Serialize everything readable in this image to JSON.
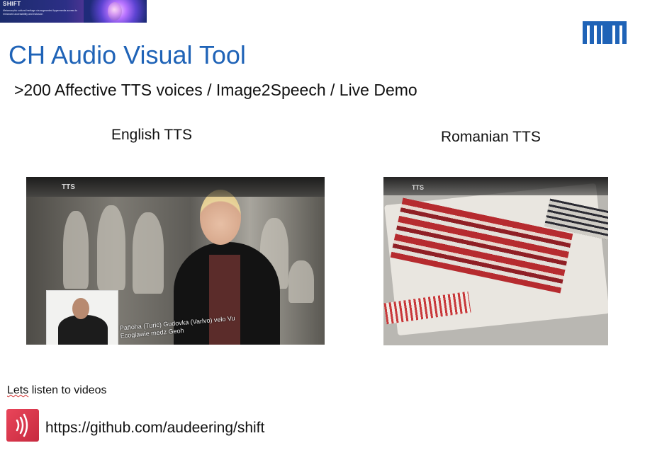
{
  "banner": {
    "title": "SHIFT",
    "tagline": "Metamorphic cultural heritage via augmented hypermedia access to enhanced accessibility and inclusion"
  },
  "logo": {
    "name": "tum-logo",
    "color": "#1f63b7"
  },
  "slide": {
    "title": "CH Audio Visual Tool",
    "subtitle": ">200 Affective TTS voices  /  Image2Speech / Live Demo"
  },
  "videos": [
    {
      "label": "English TTS",
      "overlay_label": "TTS",
      "caption": "Pañoha (Turic) Gudovka (Varlvo) velo Vu Ecoglawie medz Geoh"
    },
    {
      "label": "Romanian TTS",
      "overlay_label": "TTS"
    }
  ],
  "footer": {
    "listen_first": "Lets",
    "listen_rest": " listen to videos",
    "link": "https://github.com/audeering/shift"
  },
  "colors": {
    "title": "#1f63b7",
    "audio_icon": "#d8364c",
    "spellcheck": "#d23232"
  },
  "icons": {
    "audio": "speaker-waves-icon"
  }
}
